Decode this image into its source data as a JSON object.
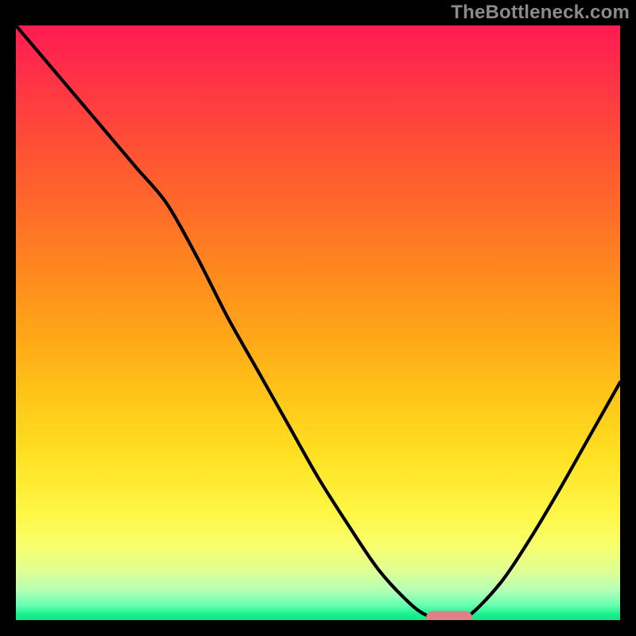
{
  "watermark": "TheBottleneck.com",
  "colors": {
    "background": "#000000",
    "curve": "#000000",
    "marker": "#e08088"
  },
  "chart_data": {
    "type": "line",
    "title": "",
    "xlabel": "",
    "ylabel": "",
    "xlim": [
      0,
      100
    ],
    "ylim": [
      0,
      100
    ],
    "grid": false,
    "legend": false,
    "annotations": [
      {
        "kind": "minimum-marker",
        "x": 71.7,
        "y": 0.4
      }
    ],
    "series": [
      {
        "name": "bottleneck-curve",
        "x": [
          0,
          5,
          10,
          15,
          20,
          25,
          30,
          35,
          40,
          45,
          50,
          55,
          60,
          65,
          68,
          71,
          74.5,
          80,
          85,
          90,
          95,
          100
        ],
        "values": [
          100,
          94,
          88,
          82,
          76,
          70,
          61,
          51,
          42,
          33,
          24,
          16,
          8.5,
          3,
          0.8,
          0.2,
          0.4,
          6,
          13.5,
          22,
          31,
          40
        ]
      }
    ]
  }
}
